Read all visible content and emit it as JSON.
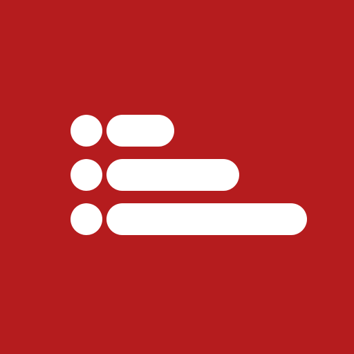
{
  "icon": {
    "name": "list-icon",
    "background_color": "#B51C1E",
    "glyph_color": "#FFFFFF",
    "rows": [
      {
        "bullet": "circle",
        "line": "short"
      },
      {
        "bullet": "circle",
        "line": "medium"
      },
      {
        "bullet": "circle",
        "line": "long"
      }
    ]
  }
}
